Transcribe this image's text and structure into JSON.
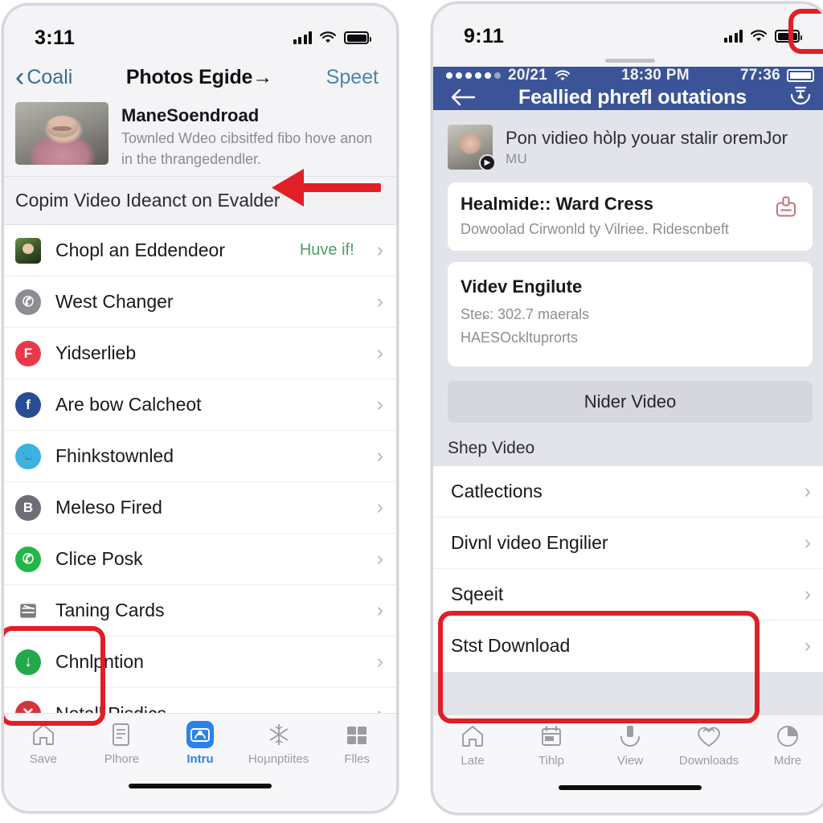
{
  "left_phone": {
    "status_bar": {
      "time": "3:11",
      "signal_icon": "cellular-bars-icon",
      "wifi_icon": "wifi-icon",
      "battery_icon": "battery-full-icon"
    },
    "nav": {
      "back_label": "Coali",
      "back_icon": "chevron-left-icon",
      "title": "Photos Egide→",
      "action_label": "Speet"
    },
    "profile": {
      "avatar": "user-photo-avatar",
      "name": "ManeSoendroad",
      "description": "Townled Wdeo cibsitfed fibo hove an‌on in the thrangedendler."
    },
    "section_header": "Copim Video Ideanct on Evalder",
    "rows": [
      {
        "label": "Chopl an Eddendeor",
        "meta": "Huve if!",
        "icon": "photos-app-icon",
        "icon_color": "#3e5a2c"
      },
      {
        "label": "West Changer",
        "meta": "",
        "icon": "messenger-gray-icon",
        "icon_color": "#8c8c92"
      },
      {
        "label": "Yidserlieb",
        "meta": "",
        "icon": "flipboard-red-icon",
        "icon_color": "#e8394a"
      },
      {
        "label": "Are bow Calcheot",
        "meta": "",
        "icon": "facebook-icon",
        "icon_color": "#2a4b96"
      },
      {
        "label": "Fhinkstownled",
        "meta": "",
        "icon": "twitter-bird-icon",
        "icon_color": "#3ab3e2"
      },
      {
        "label": "Meleso Fired",
        "meta": "",
        "icon": "bootstrap-gray-icon",
        "icon_color": "#6e6e76"
      },
      {
        "label": "Clice Posk",
        "meta": "",
        "icon": "whatsapp-green-icon",
        "icon_color": "#23b64a"
      },
      {
        "label": "Taning Cards",
        "meta": "",
        "icon": "cards-stack-icon",
        "icon_color": "#7b7b82"
      },
      {
        "label": "Chnlpntion",
        "meta": "",
        "icon": "download-circle-icon",
        "icon_color": "#22a94a"
      },
      {
        "label": "Notall Pisdics",
        "meta": "",
        "icon": "close-circle-icon",
        "icon_color": "#d6333f"
      }
    ],
    "row_chevron_icon": "chevron-right-icon",
    "tabs": [
      {
        "label": "Save",
        "icon": "home-icon",
        "active": false
      },
      {
        "label": "Plhore",
        "icon": "document-icon",
        "active": false
      },
      {
        "label": "Intru",
        "icon": "person-card-icon",
        "active": true
      },
      {
        "label": "Hoµnptiites",
        "icon": "snowflake-icon",
        "active": false
      },
      {
        "label": "Flles",
        "icon": "folder-grid-icon",
        "active": false
      }
    ]
  },
  "right_phone": {
    "status_bar": {
      "time": "9:11",
      "signal_icon": "cellular-bars-icon",
      "wifi_icon": "wifi-icon",
      "battery_icon": "battery-full-icon"
    },
    "inner_status": {
      "dots": "●●●●●●",
      "counter": "20/21",
      "wifi_icon": "wifi-icon",
      "clock": "18:30 PM",
      "battery_text": "77:36",
      "battery_icon": "battery-full-icon"
    },
    "nav": {
      "back_icon": "arrow-left-icon",
      "title": "Feallied phrefl outations",
      "right_icon": "timer-icon"
    },
    "user_row": {
      "avatar": "user-photo-avatar",
      "badge_icon": "video-badge-icon",
      "name": "Pon vidieo hòlp youar stalir oremJor",
      "sub": "MU"
    },
    "cards": [
      {
        "title": "Healmide:: Ward Cress",
        "sub": "Dowoolad Cirwonld ty Vilriee. Ridescnbeft",
        "icon": "export-upload-icon",
        "icon_color": "#c4737b"
      }
    ],
    "detail_card": {
      "title": "Videv Engilute",
      "lines": [
        "Steɕ: 302.7 maerals",
        "HAESOckltuprorts"
      ]
    },
    "primary_button": "Nider Video",
    "section_header": "Shep Video",
    "rows": [
      {
        "label": "Catlections"
      },
      {
        "label": "Divnl video Engilier"
      },
      {
        "label": "Sqeeit"
      },
      {
        "label": "Stst Download"
      }
    ],
    "row_chevron_icon": "chevron-right-icon",
    "tabs": [
      {
        "label": "Late",
        "icon": "home-icon"
      },
      {
        "label": "Tihlp",
        "icon": "calendar-icon"
      },
      {
        "label": "View",
        "icon": "download-tray-icon"
      },
      {
        "label": "Downloads",
        "icon": "heart-outline-icon"
      },
      {
        "label": "Mdre",
        "icon": "pie-chart-icon"
      }
    ]
  },
  "annotations": {
    "accent_color": "#e01f26",
    "items": [
      {
        "name": "left-section-arrow",
        "shape": "arrow-left"
      },
      {
        "name": "left-icons-highlight-box",
        "shape": "rect"
      },
      {
        "name": "right-battery-highlight-box",
        "shape": "rect"
      },
      {
        "name": "right-rows-highlight-box",
        "shape": "rect"
      }
    ]
  },
  "theme": {
    "header_blue": "#3b5498",
    "ios_bg": "#f4f4f6",
    "list_bg": "#ffffff",
    "right_body_bg": "#e3e4ea",
    "accent_blue": "#2a82ea",
    "green_text": "#4f9e68"
  }
}
